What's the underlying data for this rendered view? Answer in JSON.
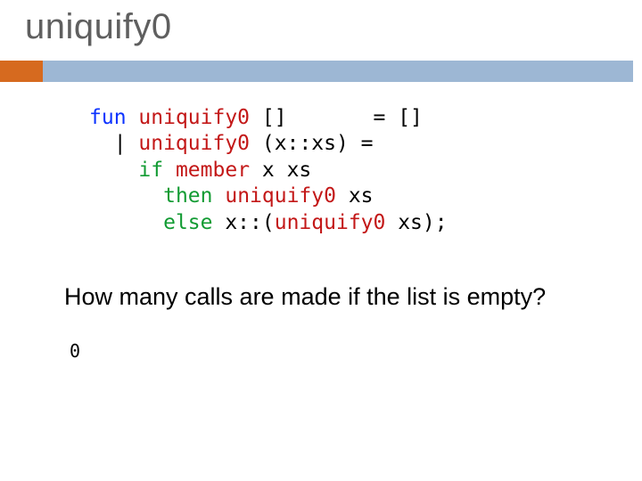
{
  "title": "uniquify0",
  "code": {
    "l1a": "fun",
    "l1b": " ",
    "l1c": "uniquify0",
    "l1d": " []       = []",
    "l2a": "  | ",
    "l2b": "uniquify0",
    "l2c": " (x::xs) =",
    "l3a": "    ",
    "l3b": "if",
    "l3c": " ",
    "l3d": "member",
    "l3e": " x xs",
    "l4a": "      ",
    "l4b": "then",
    "l4c": " ",
    "l4d": "uniquify0",
    "l4e": " xs",
    "l5a": "      ",
    "l5b": "else",
    "l5c": " x::(",
    "l5d": "uniquify0",
    "l5e": " xs);"
  },
  "question": "How many calls are made if the list is empty?",
  "answer": "0"
}
